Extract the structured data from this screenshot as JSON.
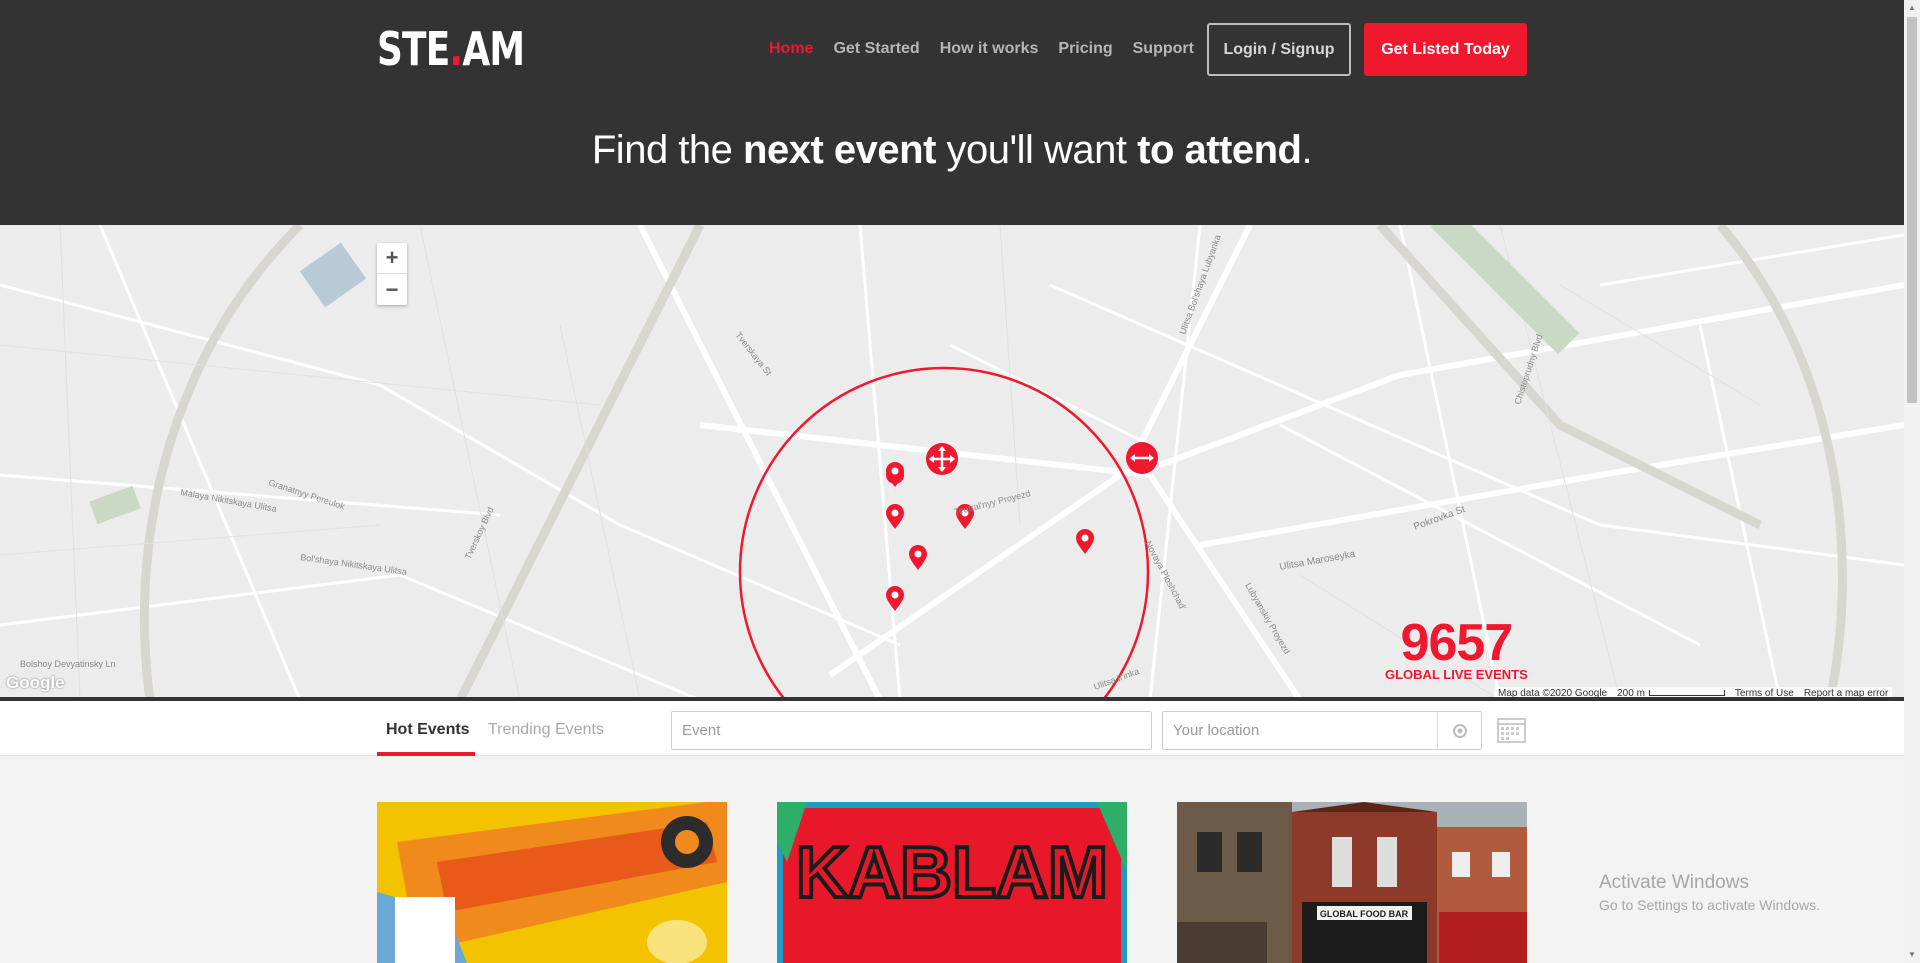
{
  "header": {
    "logo": {
      "part1": "STE",
      "dot": ".",
      "part2": "AM"
    },
    "nav": [
      {
        "label": "Home",
        "active": true
      },
      {
        "label": "Get Started",
        "active": false
      },
      {
        "label": "How it works",
        "active": false
      },
      {
        "label": "Pricing",
        "active": false
      },
      {
        "label": "Support",
        "active": false
      }
    ],
    "login_label": "Login / Signup",
    "cta_label": "Get Listed Today",
    "headline": {
      "a": "Find the ",
      "b": "next event",
      "c": " you'll want ",
      "d": "to attend",
      "e": "."
    }
  },
  "map": {
    "zoom_in": "+",
    "zoom_out": "−",
    "events_count": "9657",
    "events_label": "GLOBAL LIVE EVENTS",
    "google_logo": "Google",
    "attribution": "Map data ©2020 Google",
    "scale_label": "200 m",
    "terms": "Terms of Use",
    "report": "Report a map error",
    "streets": [
      "Tverskaya St",
      "Teatral'nyy Proyezd",
      "Ulitsa Maroseyka",
      "Pokrovka St",
      "Tverskoy Blvd",
      "Novaya Ploshchad'",
      "Lubyanskiy Proyezd",
      "Ulitsa Il'inka",
      "Bol'shaya Nikitskaya Ulitsa",
      "Chistoprudny Blvd",
      "Bolshoy Devyatinsky Ln",
      "Malaya Nikitskaya Ulitsa",
      "Granatnyy Pereulok",
      "Ulitsa Bol'shaya Lubyanka"
    ]
  },
  "search": {
    "tabs": [
      {
        "label": "Hot Events"
      },
      {
        "label": "Trending Events"
      }
    ],
    "event_placeholder": "Event",
    "location_placeholder": "Your location"
  },
  "cards": [
    {
      "name": "event-card-1"
    },
    {
      "name": "event-card-2",
      "text": "KABLAM"
    },
    {
      "name": "event-card-3",
      "text": "GLOBAL FOOD BAR"
    }
  ],
  "os": {
    "watermark_title": "Activate Windows",
    "watermark_sub": "Go to Settings to activate Windows."
  },
  "colors": {
    "accent": "#f0182f",
    "header_bg": "#333333",
    "map_bg": "#ececec"
  }
}
